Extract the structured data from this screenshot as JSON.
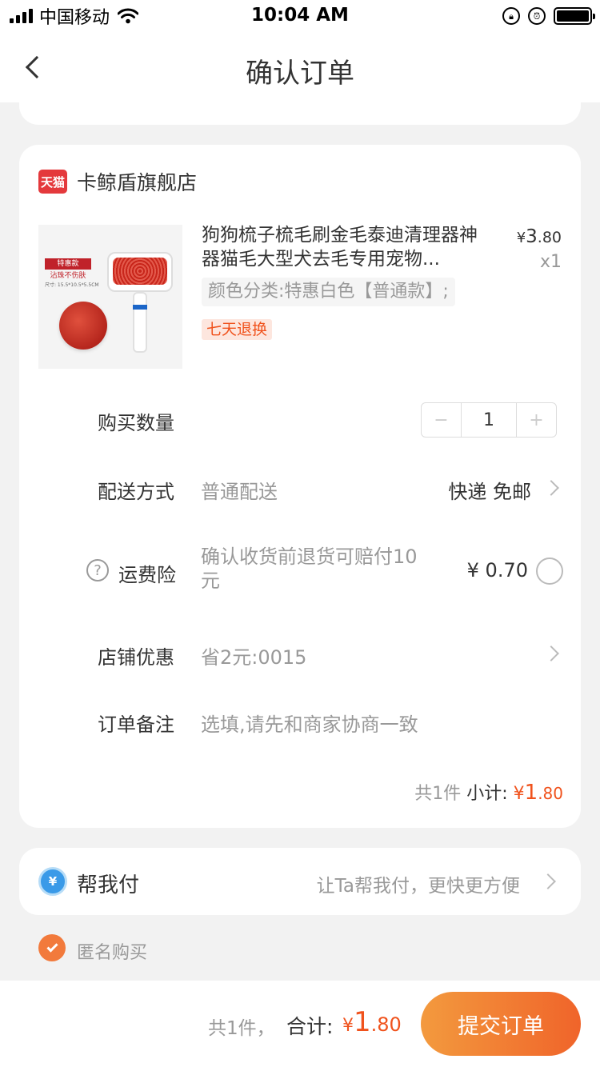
{
  "status_bar": {
    "carrier": "中国移动",
    "time": "10:04 AM",
    "icons": [
      "signal-icon",
      "wifi-icon",
      "rotation-lock-icon",
      "alarm-icon",
      "battery-icon"
    ]
  },
  "nav": {
    "title": "确认订单",
    "back_icon": "chevron-left-icon"
  },
  "store": {
    "badge": "天猫",
    "name": "卡鲸盾旗舰店",
    "product": {
      "title": "狗狗梳子梳毛刷金毛泰迪清理器神器猫毛大型犬去毛专用宠物...",
      "price_symbol": "¥",
      "price_int": "3",
      "price_dec": ".80",
      "quantity": "x1",
      "sku": "颜色分类:特惠白色【普通款】;",
      "service_tag": "七天退换",
      "image_texts": {
        "tag": "特惠款",
        "subtitle": "沾珠不伤肤",
        "dimensions": "尺寸: 15.5*10.5*5.5CM"
      }
    },
    "rows": {
      "quantity_label": "购买数量",
      "quantity_value": "1",
      "minus": "−",
      "plus": "+",
      "delivery_label": "配送方式",
      "delivery_type": "普通配送",
      "delivery_value": "快递 免邮",
      "insurance_label": "运费险",
      "insurance_desc": "确认收货前退货可赔付10元",
      "insurance_price": "¥ 0.70",
      "discount_label": "店铺优惠",
      "discount_value": "省2元:0015",
      "note_label": "订单备注",
      "note_placeholder": "选填,请先和商家协商一致"
    },
    "subtotal": {
      "count": "共1件",
      "label": "小计:",
      "symbol": "¥",
      "int": "1",
      "dec": ".80"
    }
  },
  "pay_for_me": {
    "icon_text": "¥",
    "label": "帮我付",
    "desc": "让Ta帮我付，更快更方便"
  },
  "anonymous": {
    "label": "匿名购买",
    "checked": true
  },
  "footer": {
    "count": "共1件，",
    "total_label": "合计:",
    "symbol": "¥",
    "int": "1",
    "dec": ".80",
    "submit": "提交订单"
  },
  "colors": {
    "accent": "#f0521c",
    "button_start": "#f39a3e",
    "button_end": "#f0642a",
    "tmall_red": "#e4393c",
    "pay_blue": "#3a9ae8"
  }
}
